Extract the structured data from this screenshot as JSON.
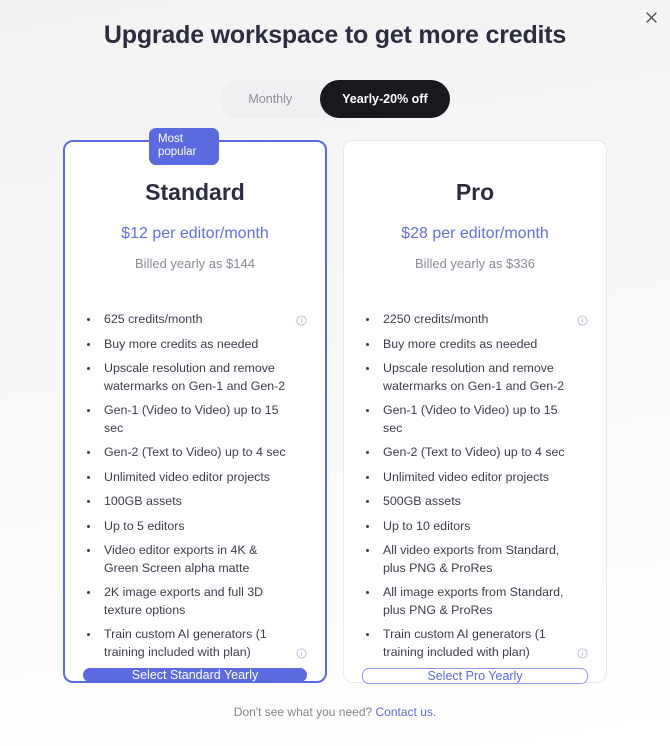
{
  "header": {
    "title": "Upgrade workspace to get more credits",
    "close_icon": "close-icon"
  },
  "billing_toggle": {
    "monthly_label": "Monthly",
    "yearly_label": "Yearly-20% off",
    "selected": "Yearly-20% off"
  },
  "colors": {
    "accent": "#5b6ade",
    "price": "#6370e0",
    "title": "#2c2e3f",
    "muted": "#8a8c99",
    "toggle_active_bg": "#18181f",
    "toggle_bg": "#f0f0f2"
  },
  "plans": [
    {
      "badge": "Most popular",
      "name": "Standard",
      "price": "$12 per editor/month",
      "billing": "Billed yearly as $144",
      "features": [
        {
          "text": "625 credits/month",
          "info": true,
          "info_pos": "top"
        },
        {
          "text": "Buy more credits as needed",
          "info": false
        },
        {
          "text": "Upscale resolution and remove watermarks on Gen-1 and Gen-2",
          "info": false
        },
        {
          "text": "Gen-1 (Video to Video) up to 15 sec",
          "info": false
        },
        {
          "text": "Gen-2 (Text to Video) up to 4 sec",
          "info": false
        },
        {
          "text": "Unlimited video editor projects",
          "info": false
        },
        {
          "text": "100GB assets",
          "info": false
        },
        {
          "text": "Up to 5 editors",
          "info": false
        },
        {
          "text": "Video editor exports in 4K & Green Screen alpha matte",
          "info": false
        },
        {
          "text": "2K image exports and full 3D texture options",
          "info": false
        },
        {
          "text": "Train custom AI generators (1 training included with plan)",
          "info": true,
          "info_pos": "mid"
        }
      ],
      "button": "Select Standard Yearly",
      "button_style": "primary"
    },
    {
      "badge": "",
      "name": "Pro",
      "price": "$28 per editor/month",
      "billing": "Billed yearly as $336",
      "features": [
        {
          "text": "2250 credits/month",
          "info": true,
          "info_pos": "top"
        },
        {
          "text": "Buy more credits as needed",
          "info": false
        },
        {
          "text": "Upscale resolution and remove watermarks on Gen-1 and Gen-2",
          "info": false
        },
        {
          "text": "Gen-1 (Video to Video) up to 15 sec",
          "info": false
        },
        {
          "text": "Gen-2 (Text to Video) up to 4 sec",
          "info": false
        },
        {
          "text": "Unlimited video editor projects",
          "info": false
        },
        {
          "text": "500GB assets",
          "info": false
        },
        {
          "text": "Up to 10 editors",
          "info": false
        },
        {
          "text": "All video exports from Standard, plus PNG & ProRes",
          "info": false
        },
        {
          "text": "All image exports from Standard, plus PNG & ProRes",
          "info": false
        },
        {
          "text": "Train custom AI generators (1 training included with plan)",
          "info": true,
          "info_pos": "mid"
        }
      ],
      "button": "Select Pro Yearly",
      "button_style": "outline"
    }
  ],
  "footer": {
    "text": "Don't see what you need?",
    "link": "Contact us."
  }
}
